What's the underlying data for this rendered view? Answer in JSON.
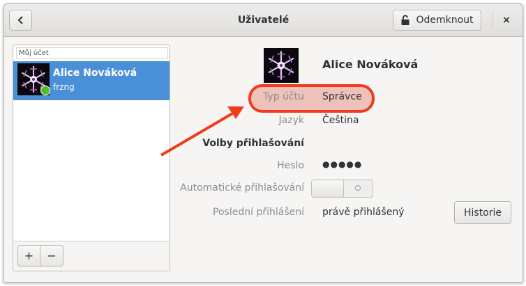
{
  "header": {
    "title": "Uživatelé",
    "unlock_label": "Odemknout",
    "back_icon": "chevron-left-icon",
    "close_glyph": "×"
  },
  "sidebar": {
    "header_label": "Můj účet",
    "user": {
      "name": "Alice Nováková",
      "username": "frzng",
      "status_color": "#4fbf26"
    },
    "add_glyph": "+",
    "remove_glyph": "−"
  },
  "details": {
    "name": "Alice Nováková",
    "account_type_label": "Typ účtu",
    "account_type_value": "Správce",
    "language_label": "Jazyk",
    "language_value": "Čeština",
    "login_options_heading": "Volby přihlašování",
    "password_label": "Heslo",
    "password_value": "●●●●●",
    "auto_login_label": "Automatické přihlašování",
    "auto_login_enabled": false,
    "last_login_label": "Poslední přihlášení",
    "last_login_value": "právě přihlášený",
    "history_button": "Historie"
  },
  "annotation": {
    "highlight_color": "#f23a1c"
  }
}
